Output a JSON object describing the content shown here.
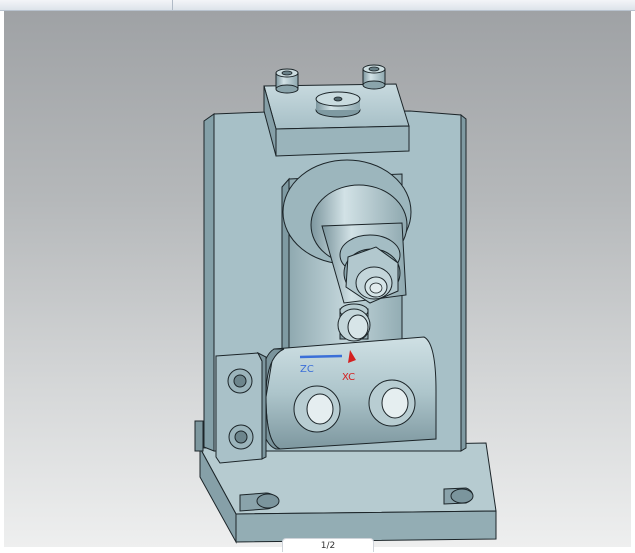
{
  "viewport": {
    "axis_labels": {
      "zc": "ZC",
      "xc": "XC"
    },
    "colors": {
      "background_top": "#9fa2a5",
      "background_bottom": "#eeefef",
      "part_base": "#a9c2c9",
      "part_shadow": "#7f9aa2",
      "part_highlight": "#d5e5e9",
      "edge": "#1c2529",
      "zc_axis": "#3b6fd8",
      "xc_axis": "#d42020"
    }
  },
  "status": {
    "page_indicator": "1/2"
  }
}
